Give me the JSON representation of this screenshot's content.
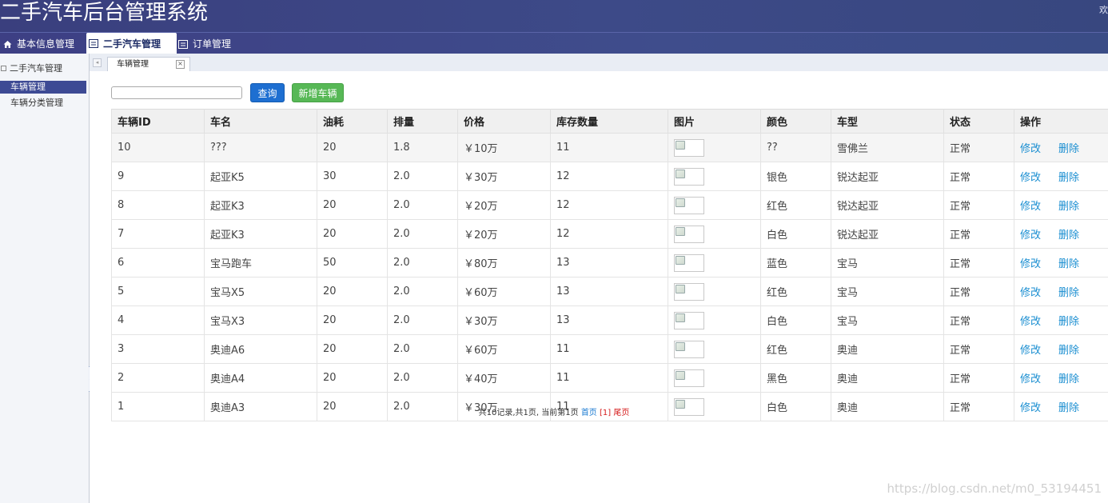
{
  "header": {
    "title": "二手汽车后台管理系统",
    "welcome": "欢"
  },
  "menu": [
    {
      "label": "基本信息管理",
      "icon": "home-icon",
      "active": false
    },
    {
      "label": "二手汽车管理",
      "icon": "list-icon",
      "active": true
    },
    {
      "label": "订单管理",
      "icon": "list-icon",
      "active": false
    }
  ],
  "sidebar": {
    "group": "二手汽车管理",
    "items": [
      {
        "label": "车辆管理",
        "active": true
      },
      {
        "label": "车辆分类管理",
        "active": false
      }
    ]
  },
  "tabs": {
    "current": "车辆管理"
  },
  "toolbar": {
    "search_value": "",
    "query_label": "查询",
    "add_label": "新增车辆"
  },
  "table": {
    "headers": [
      "车辆ID",
      "车名",
      "油耗",
      "排量",
      "价格",
      "库存数量",
      "图片",
      "颜色",
      "车型",
      "状态",
      "操作"
    ],
    "rows": [
      [
        "10",
        "???",
        "20",
        "1.8",
        "￥10万",
        "11",
        "",
        "??",
        "雪佛兰",
        "正常"
      ],
      [
        "9",
        "起亚K5",
        "30",
        "2.0",
        "￥30万",
        "12",
        "",
        "银色",
        "锐达起亚",
        "正常"
      ],
      [
        "8",
        "起亚K3",
        "20",
        "2.0",
        "￥20万",
        "12",
        "",
        "红色",
        "锐达起亚",
        "正常"
      ],
      [
        "7",
        "起亚K3",
        "20",
        "2.0",
        "￥20万",
        "12",
        "",
        "白色",
        "锐达起亚",
        "正常"
      ],
      [
        "6",
        "宝马跑车",
        "50",
        "2.0",
        "￥80万",
        "13",
        "",
        "蓝色",
        "宝马",
        "正常"
      ],
      [
        "5",
        "宝马X5",
        "20",
        "2.0",
        "￥60万",
        "13",
        "",
        "红色",
        "宝马",
        "正常"
      ],
      [
        "4",
        "宝马X3",
        "20",
        "2.0",
        "￥30万",
        "13",
        "",
        "白色",
        "宝马",
        "正常"
      ],
      [
        "3",
        "奥迪A6",
        "20",
        "2.0",
        "￥60万",
        "11",
        "",
        "红色",
        "奥迪",
        "正常"
      ],
      [
        "2",
        "奥迪A4",
        "20",
        "2.0",
        "￥40万",
        "11",
        "",
        "黑色",
        "奥迪",
        "正常"
      ],
      [
        "1",
        "奥迪A3",
        "20",
        "2.0",
        "￥30万",
        "11",
        "",
        "白色",
        "奥迪",
        "正常"
      ]
    ],
    "edit_label": "修改",
    "delete_label": "删除"
  },
  "pager": {
    "summary": "共10记录,共1页, 当前第1页 ",
    "first": "首页",
    "current": " [1] ",
    "last": "尾页"
  },
  "watermark": "https://blog.csdn.net/m0_53194451"
}
